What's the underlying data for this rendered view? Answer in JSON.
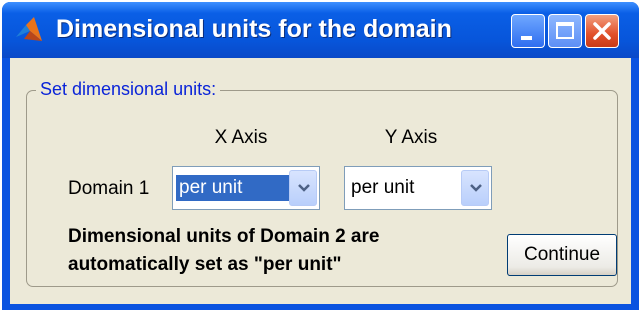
{
  "window": {
    "title": "Dimensional units for the domain",
    "buttons": [
      "minimize",
      "maximize",
      "close"
    ]
  },
  "panel": {
    "label": "Set dimensional units:"
  },
  "columns": {
    "x_axis": "X Axis",
    "y_axis": "Y Axis"
  },
  "rows": [
    {
      "label": "Domain 1",
      "x_value": "per unit",
      "y_value": "per unit"
    }
  ],
  "note": {
    "line1": "Dimensional units of Domain 2 are",
    "line2": "automatically set as \"per unit\""
  },
  "actions": {
    "continue_label": "Continue"
  },
  "colors": {
    "titlebar": "#0755DA",
    "client_bg": "#ECE9D8",
    "panel_label": "#0A24D8",
    "selection": "#316AC5"
  }
}
